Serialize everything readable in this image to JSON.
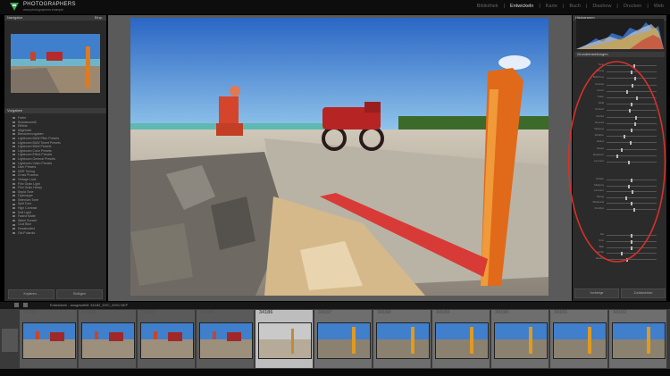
{
  "app": {
    "brand": "PHOTOGRAPHERS",
    "tagline": "www.photographers.example",
    "modules": [
      {
        "label": "Bibliothek",
        "active": false
      },
      {
        "label": "Entwickeln",
        "active": true
      },
      {
        "label": "Karte",
        "active": false
      },
      {
        "label": "Buch",
        "active": false
      },
      {
        "label": "Diashow",
        "active": false
      },
      {
        "label": "Drucken",
        "active": false
      },
      {
        "label": "Web",
        "active": false
      }
    ]
  },
  "left_panel": {
    "navigator_label": "Navigator",
    "navigator_zoom": "Einp.",
    "presets_label": "Vorgaben",
    "tree_items": [
      "Farbe",
      "Schwarzweiß",
      "Effekte",
      "Allgemein",
      "Benutzervorgaben",
      "Lightroom B&W Filter Presets",
      "Lightroom B&W Toned Presets",
      "Lightroom B&W Presets",
      "Lightroom Color Presets",
      "Lightroom Effect Presets",
      "Lightroom General Presets",
      "Lightroom Video Presets",
      "User Presets",
      "HDR Toning",
      "Cross Process",
      "Vintage Look",
      "Film Grain Light",
      "Film Grain Heavy",
      "Sepia Tone",
      "Cyanotype",
      "Selenium Tone",
      "Split Tone",
      "High Contrast",
      "Soft Light",
      "Faded Matte",
      "Warm Sunset",
      "Cool Blue",
      "Desaturated",
      "Old Polaroid"
    ],
    "copy_button": "Kopieren...",
    "paste_button": "Einfügen"
  },
  "right_panel": {
    "histogram_label": "Histogramm",
    "basic_label": "Grundeinstellungen",
    "sliders_a": [
      {
        "label": "Temp",
        "value": 0.55
      },
      {
        "label": "Tönung",
        "value": 0.5
      },
      {
        "label": "Belichtung",
        "value": 0.58
      },
      {
        "label": "Kontrast",
        "value": 0.52
      },
      {
        "label": "Lichter",
        "value": 0.4
      },
      {
        "label": "Tiefen",
        "value": 0.62
      },
      {
        "label": "Weiß",
        "value": 0.5
      },
      {
        "label": "Schwarz",
        "value": 0.46
      },
      {
        "label": "Klarheit",
        "value": 0.6
      },
      {
        "label": "Dynamik",
        "value": 0.57
      },
      {
        "label": "Sättigung",
        "value": 0.5
      },
      {
        "label": "Schärfen",
        "value": 0.35
      },
      {
        "label": "Radius",
        "value": 0.48
      },
      {
        "label": "Details",
        "value": 0.3
      },
      {
        "label": "Maskieren",
        "value": 0.2
      },
      {
        "label": "Luminanz",
        "value": 0.45
      }
    ],
    "sliders_b": [
      {
        "label": "Farbton",
        "value": 0.5
      },
      {
        "label": "Sättigung",
        "value": 0.44
      },
      {
        "label": "Luminanz",
        "value": 0.52
      },
      {
        "label": "Betrag",
        "value": 0.38
      },
      {
        "label": "Mittelpunkt",
        "value": 0.5
      },
      {
        "label": "Rundheit",
        "value": 0.55
      }
    ],
    "sliders_c": [
      {
        "label": "Rot",
        "value": 0.5
      },
      {
        "label": "Grün",
        "value": 0.5
      },
      {
        "label": "Blau",
        "value": 0.5
      },
      {
        "label": "Größe",
        "value": 0.3
      },
      {
        "label": "Rauheit",
        "value": 0.4
      }
    ],
    "previous_button": "Vorherige",
    "reset_button": "Zurücksetzen"
  },
  "toolbar": {
    "path_text": "Entwickeln - ausgewählt: 34182_DSC_0001.NEF"
  },
  "filmstrip": {
    "frames": [
      {
        "num": "34182",
        "scene": "moto"
      },
      {
        "num": "34183",
        "scene": "moto"
      },
      {
        "num": "34184",
        "scene": "moto"
      },
      {
        "num": "34185",
        "scene": "moto"
      },
      {
        "num": "34186",
        "scene": "road"
      },
      {
        "num": "34187",
        "scene": "post"
      },
      {
        "num": "34188",
        "scene": "post"
      },
      {
        "num": "34189",
        "scene": "post"
      },
      {
        "num": "34190",
        "scene": "post"
      },
      {
        "num": "34191",
        "scene": "post"
      },
      {
        "num": "34192",
        "scene": "post"
      }
    ]
  },
  "colors": {
    "annotation_red": "#d9302a",
    "brand_green": "#3aa84a"
  }
}
